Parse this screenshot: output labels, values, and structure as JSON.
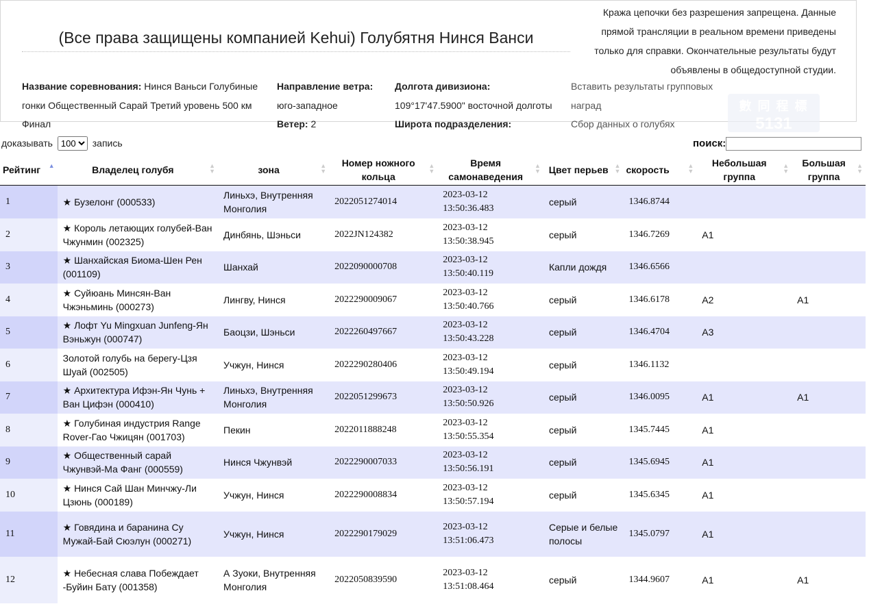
{
  "header": {
    "title": "(Все права защищены компанией Kehui) Голубятня Нинся Ванси",
    "notice": "Кража цепочки без разрешения запрещена. Данные прямой трансляции в реальном времени приведены только для справки. Окончательные результаты будут объявлены в общедоступной студии."
  },
  "info": {
    "race_label": "Название соревнования:",
    "race_value": "Нинся Ваньси Голубиные гонки Общественный Сарай Третий уровень 500 км Финал",
    "wind_dir_label": "Направление ветра:",
    "wind_dir_value": "юго-западное",
    "wind_label": "Ветер:",
    "wind_value": "2",
    "lon_label": "Долгота дивизиона:",
    "lon_value": "109°17'47.5900\" восточной долготы",
    "lat_label": "Широта подразделения:",
    "link_insert": "Вставить результаты групповых наград",
    "link_collect": "Сбор данных о голубях"
  },
  "watermark": {
    "line1": "數 同 程 標",
    "line2": "5131"
  },
  "controls": {
    "show_label": "доказывать",
    "show_value": "100",
    "records_label": "запись",
    "search_label": "поиск:",
    "search_value": ""
  },
  "columns": [
    "Рейтинг",
    "Владелец голубя",
    "зона",
    "Номер ножного кольца",
    "Время самонаведения",
    "Цвет перьев",
    "скорость",
    "Небольшая группа",
    "Большая группа"
  ],
  "rows": [
    {
      "rank": "1",
      "owner": "★ Бузелонг (000533)",
      "zone": "Линьхэ, Внутренняя Монголия",
      "ring": "2022051274014",
      "date": "2023-03-12",
      "time": "13:50:36.483",
      "color": "серый",
      "speed": "1346.8744",
      "small": "",
      "big": ""
    },
    {
      "rank": "2",
      "owner": "★ Король летающих голубей-Ван Чжунмин (002325)",
      "zone": "Динбянь, Шэньси",
      "ring": "2022JN124382",
      "date": "2023-03-12",
      "time": "13:50:38.945",
      "color": "серый",
      "speed": "1346.7269",
      "small": "A1",
      "big": ""
    },
    {
      "rank": "3",
      "owner": "★ Шанхайская Биома-Шен Рен (001109)",
      "zone": "Шанхай",
      "ring": "2022090000708",
      "date": "2023-03-12",
      "time": "13:50:40.119",
      "color": "Капли дождя",
      "speed": "1346.6566",
      "small": "",
      "big": ""
    },
    {
      "rank": "4",
      "owner": "★ Суйюань Минсян-Ван Чжэньминь (000273)",
      "zone": "Лингву, Нинся",
      "ring": "2022290009067",
      "date": "2023-03-12",
      "time": "13:50:40.766",
      "color": "серый",
      "speed": "1346.6178",
      "small": "A2",
      "big": "A1"
    },
    {
      "rank": "5",
      "owner": "★ Лофт Yu Mingxuan Junfeng-Ян Вэньжун (000747)",
      "zone": "Баоцзи, Шэньси",
      "ring": "2022260497667",
      "date": "2023-03-12",
      "time": "13:50:43.228",
      "color": "серый",
      "speed": "1346.4704",
      "small": "A3",
      "big": ""
    },
    {
      "rank": "6",
      "owner": "Золотой голубь на берегу-Цзя Шуай (002505)",
      "zone": "Учжун, Нинся",
      "ring": "2022290280406",
      "date": "2023-03-12",
      "time": "13:50:49.194",
      "color": "серый",
      "speed": "1346.1132",
      "small": "",
      "big": ""
    },
    {
      "rank": "7",
      "owner": "★ Архитектура Ифэн-Ян Чунь + Ван Цифэн (000410)",
      "zone": "Линьхэ, Внутренняя Монголия",
      "ring": "2022051299673",
      "date": "2023-03-12",
      "time": "13:50:50.926",
      "color": "серый",
      "speed": "1346.0095",
      "small": "A1",
      "big": "A1"
    },
    {
      "rank": "8",
      "owner": "★ Голубиная индустрия Range Rover-Гао Чжицян (001703)",
      "zone": "Пекин",
      "ring": "2022011888248",
      "date": "2023-03-12",
      "time": "13:50:55.354",
      "color": "серый",
      "speed": "1345.7445",
      "small": "A1",
      "big": ""
    },
    {
      "rank": "9",
      "owner": "★ Общественный сарай Чжунвэй-Ма Фанг (000559)",
      "zone": "Нинся Чжунвэй",
      "ring": "2022290007033",
      "date": "2023-03-12",
      "time": "13:50:56.191",
      "color": "серый",
      "speed": "1345.6945",
      "small": "A1",
      "big": ""
    },
    {
      "rank": "10",
      "owner": "★ Нинся Сай Шан Минчжу-Ли Цзюнь (000189)",
      "zone": "Учжун, Нинся",
      "ring": "2022290008834",
      "date": "2023-03-12",
      "time": "13:50:57.194",
      "color": "серый",
      "speed": "1345.6345",
      "small": "A1",
      "big": ""
    },
    {
      "rank": "11",
      "owner": "★ Говядина и баранина Су Мужай-Бай Сюэлун (000271)",
      "zone": "Учжун, Нинся",
      "ring": "2022290179029",
      "date": "2023-03-12",
      "time": "13:51:06.473",
      "color": "Серые и белые полосы",
      "speed": "1345.0797",
      "small": "A1",
      "big": ""
    },
    {
      "rank": "12",
      "owner": "★ Небесная слава Побеждает -Буйин Бату (001358)",
      "zone": "А Зуоки, Внутренняя Монголия",
      "ring": "2022050839590",
      "date": "2023-03-12",
      "time": "13:51:08.464",
      "color": "серый",
      "speed": "1344.9607",
      "small": "A1",
      "big": "A1"
    }
  ]
}
